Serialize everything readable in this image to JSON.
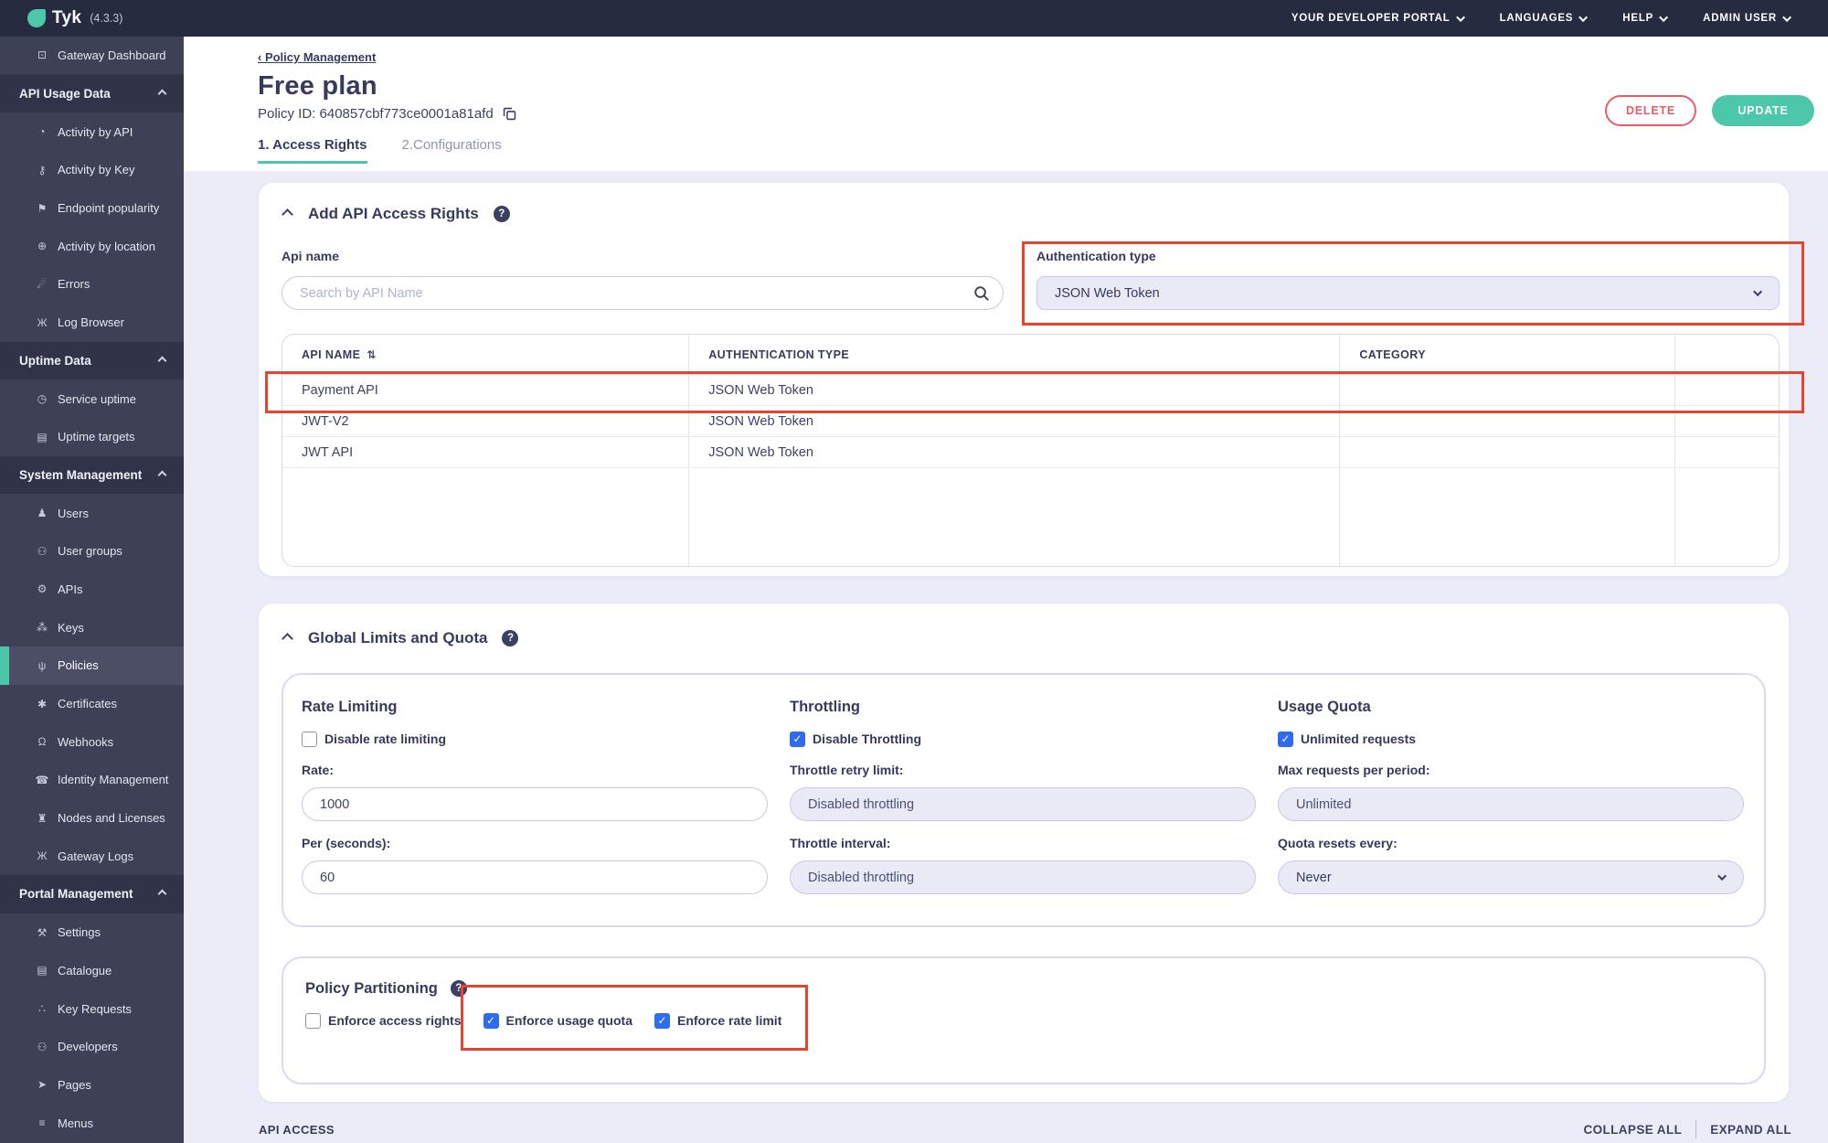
{
  "colors": {
    "accent_teal": "#4cc7a9",
    "delete_red": "#e85d68",
    "annotation_red": "#e8432c",
    "topbar_bg": "#272b40",
    "sidebar_bg": "#3e4156",
    "sidebar_header_bg": "#313349",
    "sidebar_active_bg": "#4b4e64",
    "page_bg": "#ebecf7",
    "dark_navy": "#363b5e",
    "disabled_bg": "#e9eaf6",
    "checkbox_blue": "#2d6cf0"
  },
  "topbar": {
    "logo_text": "Tyk",
    "version": "(4.3.3)",
    "menus": [
      {
        "label": "YOUR DEVELOPER PORTAL"
      },
      {
        "label": "LANGUAGES"
      },
      {
        "label": "HELP"
      },
      {
        "label": "ADMIN USER"
      }
    ]
  },
  "sidebar": {
    "rows": [
      {
        "type": "item",
        "label": "Gateway Dashboard",
        "icon": "⊡"
      },
      {
        "type": "header",
        "label": "API Usage Data"
      },
      {
        "type": "item",
        "label": "Activity by API",
        "icon": "◔"
      },
      {
        "type": "item",
        "label": "Activity by Key",
        "icon": "⚷"
      },
      {
        "type": "item",
        "label": "Endpoint popularity",
        "icon": "⚑"
      },
      {
        "type": "item",
        "label": "Activity by location",
        "icon": "⊕"
      },
      {
        "type": "item",
        "label": "Errors",
        "icon": "☄"
      },
      {
        "type": "item",
        "label": "Log Browser",
        "icon": "Ж"
      },
      {
        "type": "header",
        "label": "Uptime Data"
      },
      {
        "type": "item",
        "label": "Service uptime",
        "icon": "◷"
      },
      {
        "type": "item",
        "label": "Uptime targets",
        "icon": "▤"
      },
      {
        "type": "header",
        "label": "System Management"
      },
      {
        "type": "item",
        "label": "Users",
        "icon": "♟"
      },
      {
        "type": "item",
        "label": "User groups",
        "icon": "⚇"
      },
      {
        "type": "item",
        "label": "APIs",
        "icon": "⚙"
      },
      {
        "type": "item",
        "label": "Keys",
        "icon": "⁂"
      },
      {
        "type": "item",
        "label": "Policies",
        "icon": "ψ",
        "active": true
      },
      {
        "type": "item",
        "label": "Certificates",
        "icon": "✱"
      },
      {
        "type": "item",
        "label": "Webhooks",
        "icon": "Ω"
      },
      {
        "type": "item",
        "label": "Identity Management",
        "icon": "☎"
      },
      {
        "type": "item",
        "label": "Nodes and Licenses",
        "icon": "♜"
      },
      {
        "type": "item",
        "label": "Gateway Logs",
        "icon": "Ж"
      },
      {
        "type": "header",
        "label": "Portal Management"
      },
      {
        "type": "item",
        "label": "Settings",
        "icon": "⚒"
      },
      {
        "type": "item",
        "label": "Catalogue",
        "icon": "▤"
      },
      {
        "type": "item",
        "label": "Key Requests",
        "icon": "∴"
      },
      {
        "type": "item",
        "label": "Developers",
        "icon": "⚇"
      },
      {
        "type": "item",
        "label": "Pages",
        "icon": "➤"
      },
      {
        "type": "item",
        "label": "Menus",
        "icon": "≡"
      }
    ]
  },
  "header": {
    "breadcrumb": "‹ Policy Management",
    "title": "Free plan",
    "policy_id": "Policy ID: 640857cbf773ce0001a81afd",
    "delete_label": "DELETE",
    "update_label": "UPDATE",
    "tabs": [
      {
        "label": "1. Access Rights"
      },
      {
        "label": "2.Configurations"
      }
    ]
  },
  "access_rights": {
    "title": "Add API Access Rights",
    "api_name_label": "Api name",
    "search_placeholder": "Search by API Name",
    "auth_type_label": "Authentication type",
    "auth_type_value": "JSON Web Token",
    "table": {
      "headers": [
        "API NAME",
        "AUTHENTICATION TYPE",
        "CATEGORY",
        ""
      ],
      "sort_icon": "⇅",
      "rows": [
        {
          "api_name": "Payment API",
          "auth_type": "JSON Web Token",
          "category": ""
        },
        {
          "api_name": "JWT-V2",
          "auth_type": "JSON Web Token",
          "category": ""
        },
        {
          "api_name": "JWT API",
          "auth_type": "JSON Web Token",
          "category": ""
        }
      ]
    }
  },
  "limits": {
    "title": "Global Limits and Quota",
    "rate": {
      "title": "Rate Limiting",
      "disable_label": "Disable rate limiting",
      "disable_checked": false,
      "rate_label": "Rate:",
      "rate_value": "1000",
      "per_label": "Per (seconds):",
      "per_value": "60"
    },
    "throttling": {
      "title": "Throttling",
      "disable_label": "Disable Throttling",
      "disable_checked": true,
      "retry_label": "Throttle retry limit:",
      "retry_value": "Disabled throttling",
      "interval_label": "Throttle interval:",
      "interval_value": "Disabled throttling"
    },
    "quota": {
      "title": "Usage Quota",
      "unlimited_label": "Unlimited requests",
      "unlimited_checked": true,
      "max_label": "Max requests per period:",
      "max_value": "Unlimited",
      "resets_label": "Quota resets every:",
      "resets_value": "Never"
    }
  },
  "partitioning": {
    "title": "Policy Partitioning",
    "checkboxes": [
      {
        "label": "Enforce access rights",
        "checked": false
      },
      {
        "label": "Enforce usage quota",
        "checked": true
      },
      {
        "label": "Enforce rate limit",
        "checked": true
      }
    ]
  },
  "footer": {
    "left_label": "API ACCESS",
    "collapse_label": "COLLAPSE ALL",
    "expand_label": "EXPAND ALL"
  }
}
